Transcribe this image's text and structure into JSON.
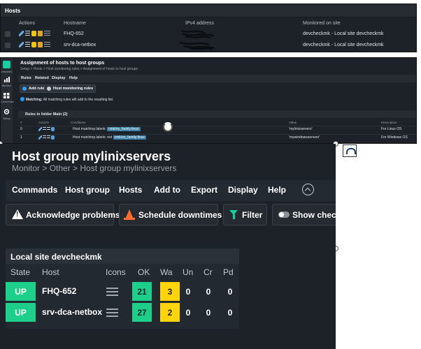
{
  "hosts_panel": {
    "title": "Hosts",
    "columns": [
      "Actions",
      "Hostname",
      "IPv4 address",
      "Monitored on site"
    ],
    "rows": [
      {
        "hostname": "FHQ-652",
        "site": "devcheckmk - Local site devcheckmk"
      },
      {
        "hostname": "srv-dca-netbox",
        "site": "devcheckmk - Local site devcheckmk"
      }
    ]
  },
  "rules_panel": {
    "sidebar": {
      "logo": "checkmk",
      "items": [
        "Monitor",
        "Customize",
        "Setup"
      ]
    },
    "title": "Assignment of hosts to host groups",
    "breadcrumb": "Setup > Hosts > Host monitoring rules > Assignment of hosts to host groups",
    "menu": [
      "Rules",
      "Related",
      "Display",
      "Help"
    ],
    "buttons": [
      "Add rule",
      "Host monitoring rules"
    ],
    "matching_label": "Matching:",
    "matching_text": "All matching rules will add to the resulting list.",
    "folder_header": "Rules in folder Main (2)",
    "columns": [
      "#",
      "Actions",
      "Conditions",
      "Value",
      "Description"
    ],
    "rules": [
      {
        "num": "0",
        "condition": "Host matching labels:",
        "negation": "",
        "tag": "cmk/os_family:linux",
        "value": "'mylinixservers'",
        "description": "For Linux OS"
      },
      {
        "num": "1",
        "condition": "Host matching labels:",
        "negation": "not",
        "tag": "cmk/os_family:linux",
        "value": "'mywindowsservers'",
        "description": "For Windows OS"
      }
    ]
  },
  "hostgroup_page": {
    "title": "Host group mylinixservers",
    "breadcrumb": "Monitor > Other > Host group mylinixservers",
    "menu": [
      "Commands",
      "Host group",
      "Hosts",
      "Add to",
      "Export",
      "Display",
      "Help"
    ],
    "actions": [
      "Acknowledge problems",
      "Schedule downtimes",
      "Filter",
      "Show checkboxes"
    ],
    "site_title": "Local site devcheckmk",
    "columns": [
      "State",
      "Host",
      "Icons",
      "OK",
      "Wa",
      "Un",
      "Cr",
      "Pd"
    ],
    "rows": [
      {
        "state": "UP",
        "host": "FHQ-652",
        "ok": "21",
        "wa": "3",
        "un": "0",
        "cr": "0",
        "pd": "0"
      },
      {
        "state": "UP",
        "host": "srv-dca-netbox",
        "ok": "27",
        "wa": "2",
        "un": "0",
        "cr": "0",
        "pd": "0"
      }
    ]
  },
  "colors": {
    "background": "#1d2228",
    "state_up": "#1ecf8c",
    "warn": "#ffd40a",
    "accent": "#15d1a0"
  }
}
